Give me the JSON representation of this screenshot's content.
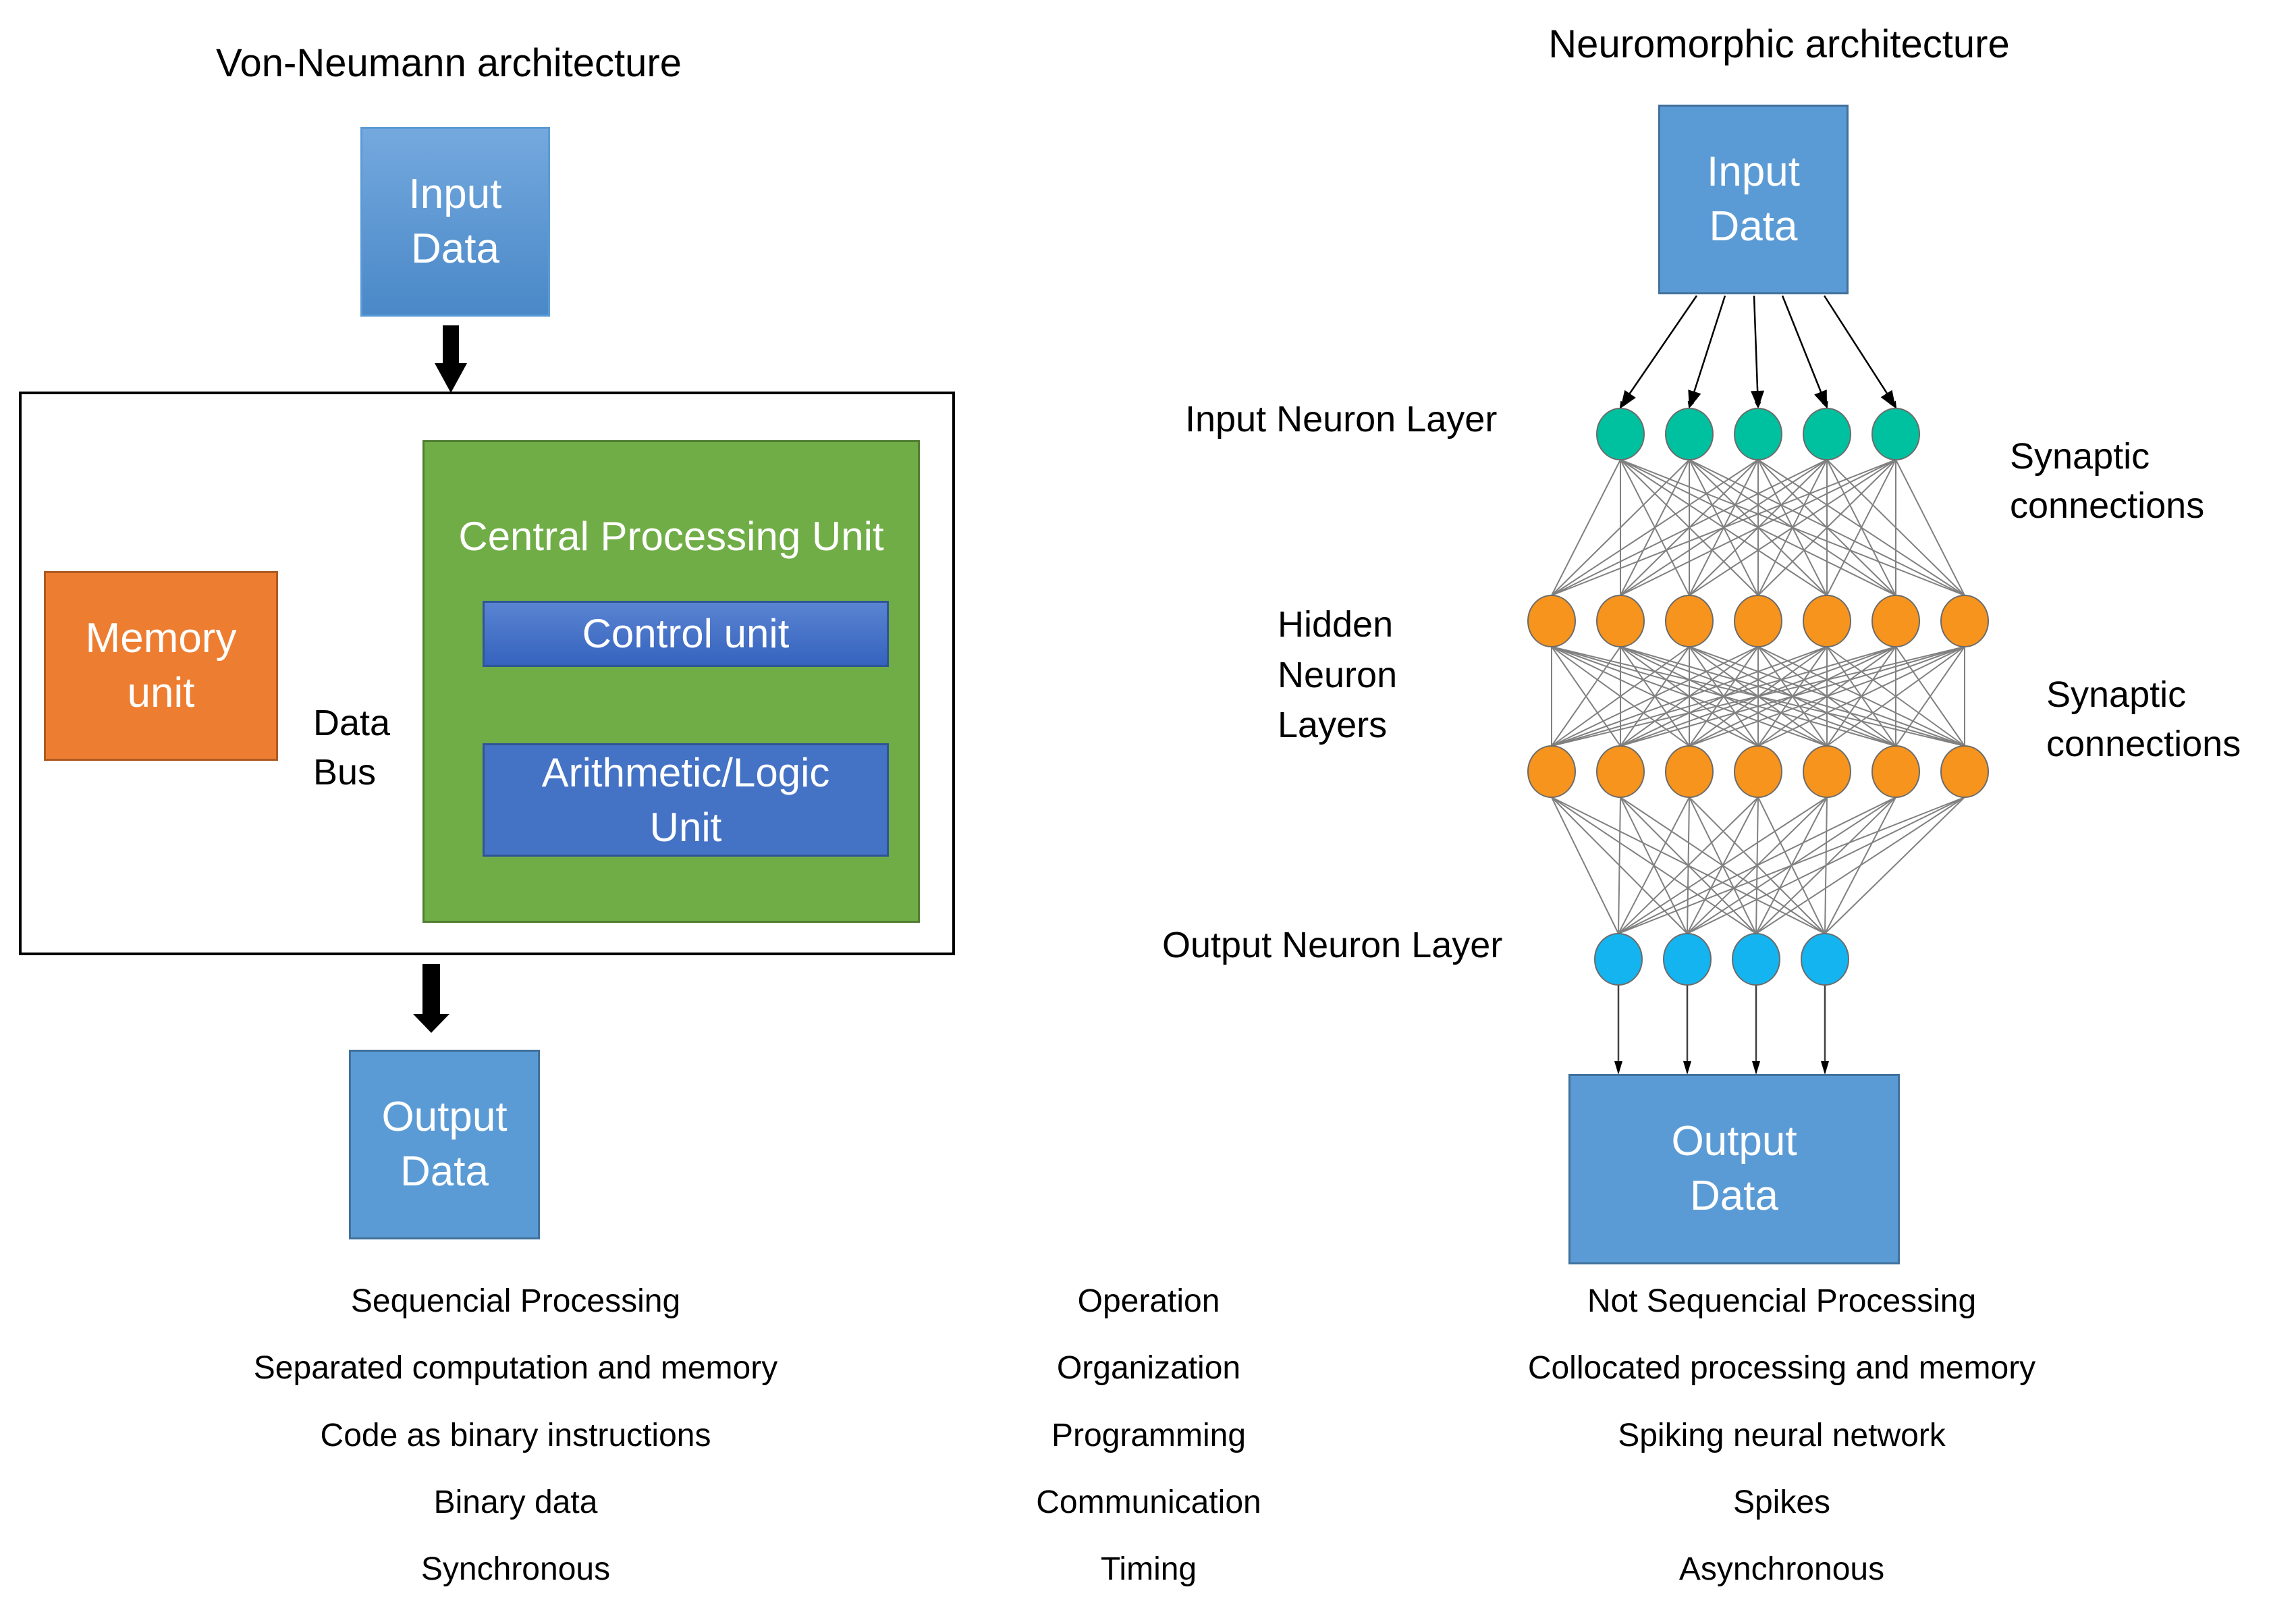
{
  "von_neumann": {
    "title": "Von-Neumann architecture",
    "input_box": {
      "line1": "Input",
      "line2": "Data"
    },
    "memory_unit": {
      "line1": "Memory",
      "line2": "unit"
    },
    "data_bus": {
      "line1": "Data",
      "line2": "Bus"
    },
    "cpu": {
      "title": "Central Processing Unit",
      "control_unit": "Control unit",
      "alu": {
        "line1": "Arithmetic/Logic",
        "line2": "Unit"
      }
    },
    "output_box": {
      "line1": "Output",
      "line2": "Data"
    }
  },
  "neuromorphic": {
    "title": "Neuromorphic architecture",
    "input_box": {
      "line1": "Input",
      "line2": "Data"
    },
    "input_layer_label": "Input Neuron  Layer",
    "hidden_layer_label": {
      "line1": "Hidden",
      "line2": "Neuron",
      "line3": "Layers"
    },
    "output_layer_label": "Output Neuron  Layer",
    "synaptic_label_1": {
      "line1": "Synaptic",
      "line2": "connections"
    },
    "synaptic_label_2": {
      "line1": "Synaptic",
      "line2": "connections"
    },
    "output_box": {
      "line1": "Output",
      "line2": "Data"
    },
    "network": {
      "layers": [
        {
          "name": "input",
          "count": 5,
          "color": "#00c19f"
        },
        {
          "name": "hidden-1",
          "count": 7,
          "color": "#f7941d"
        },
        {
          "name": "hidden-2",
          "count": 7,
          "color": "#f7941d"
        },
        {
          "name": "output",
          "count": 4,
          "color": "#14b4f0"
        }
      ],
      "connection": "fully-connected",
      "edge_color": "#808080"
    }
  },
  "comparison": {
    "rows": [
      {
        "von_neumann": "Sequencial Processing",
        "aspect": "Operation",
        "neuromorphic": "Not Sequencial Processing"
      },
      {
        "von_neumann": "Separated computation and memory",
        "aspect": "Organization",
        "neuromorphic": "Collocated processing and memory"
      },
      {
        "von_neumann": "Code as binary instructions",
        "aspect": "Programming",
        "neuromorphic": "Spiking neural network"
      },
      {
        "von_neumann": "Binary data",
        "aspect": "Communication",
        "neuromorphic": "Spikes"
      },
      {
        "von_neumann": "Synchronous",
        "aspect": "Timing",
        "neuromorphic": "Asynchronous"
      }
    ]
  }
}
